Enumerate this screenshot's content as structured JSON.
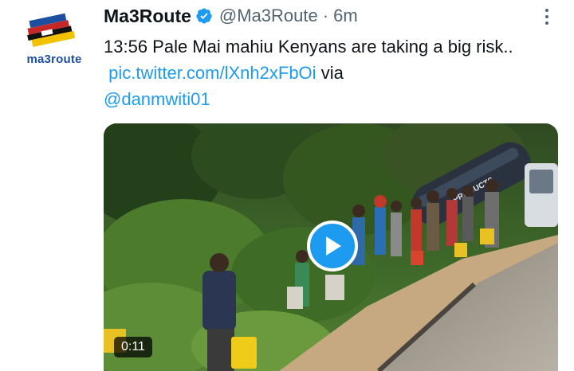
{
  "account": {
    "avatar_logo_text": "ma3route",
    "name": "Ma3Route",
    "handle": "@Ma3Route",
    "separator": "·",
    "time_ago": "6m"
  },
  "tweet": {
    "text_prefix": "13:56 Pale Mai mahiu Kenyans are taking a big risk..",
    "link_text": "pic.twitter.com/lXnh2xFbOi",
    "via_text": "via",
    "mention": "@danmwiti01"
  },
  "media": {
    "type": "video",
    "duration": "0:11",
    "scene": "overturned tanker truck on hillside road with people carrying jerrycans",
    "truck_side_text": "PRODUCTS"
  },
  "icons": {
    "verified": "verified-badge-icon",
    "more": "more-options-icon",
    "play": "play-icon"
  },
  "colors": {
    "link": "#1d9bf0",
    "secondary_text": "#536471",
    "primary_text": "#0f1419",
    "play_button": "#1d9bf0"
  }
}
